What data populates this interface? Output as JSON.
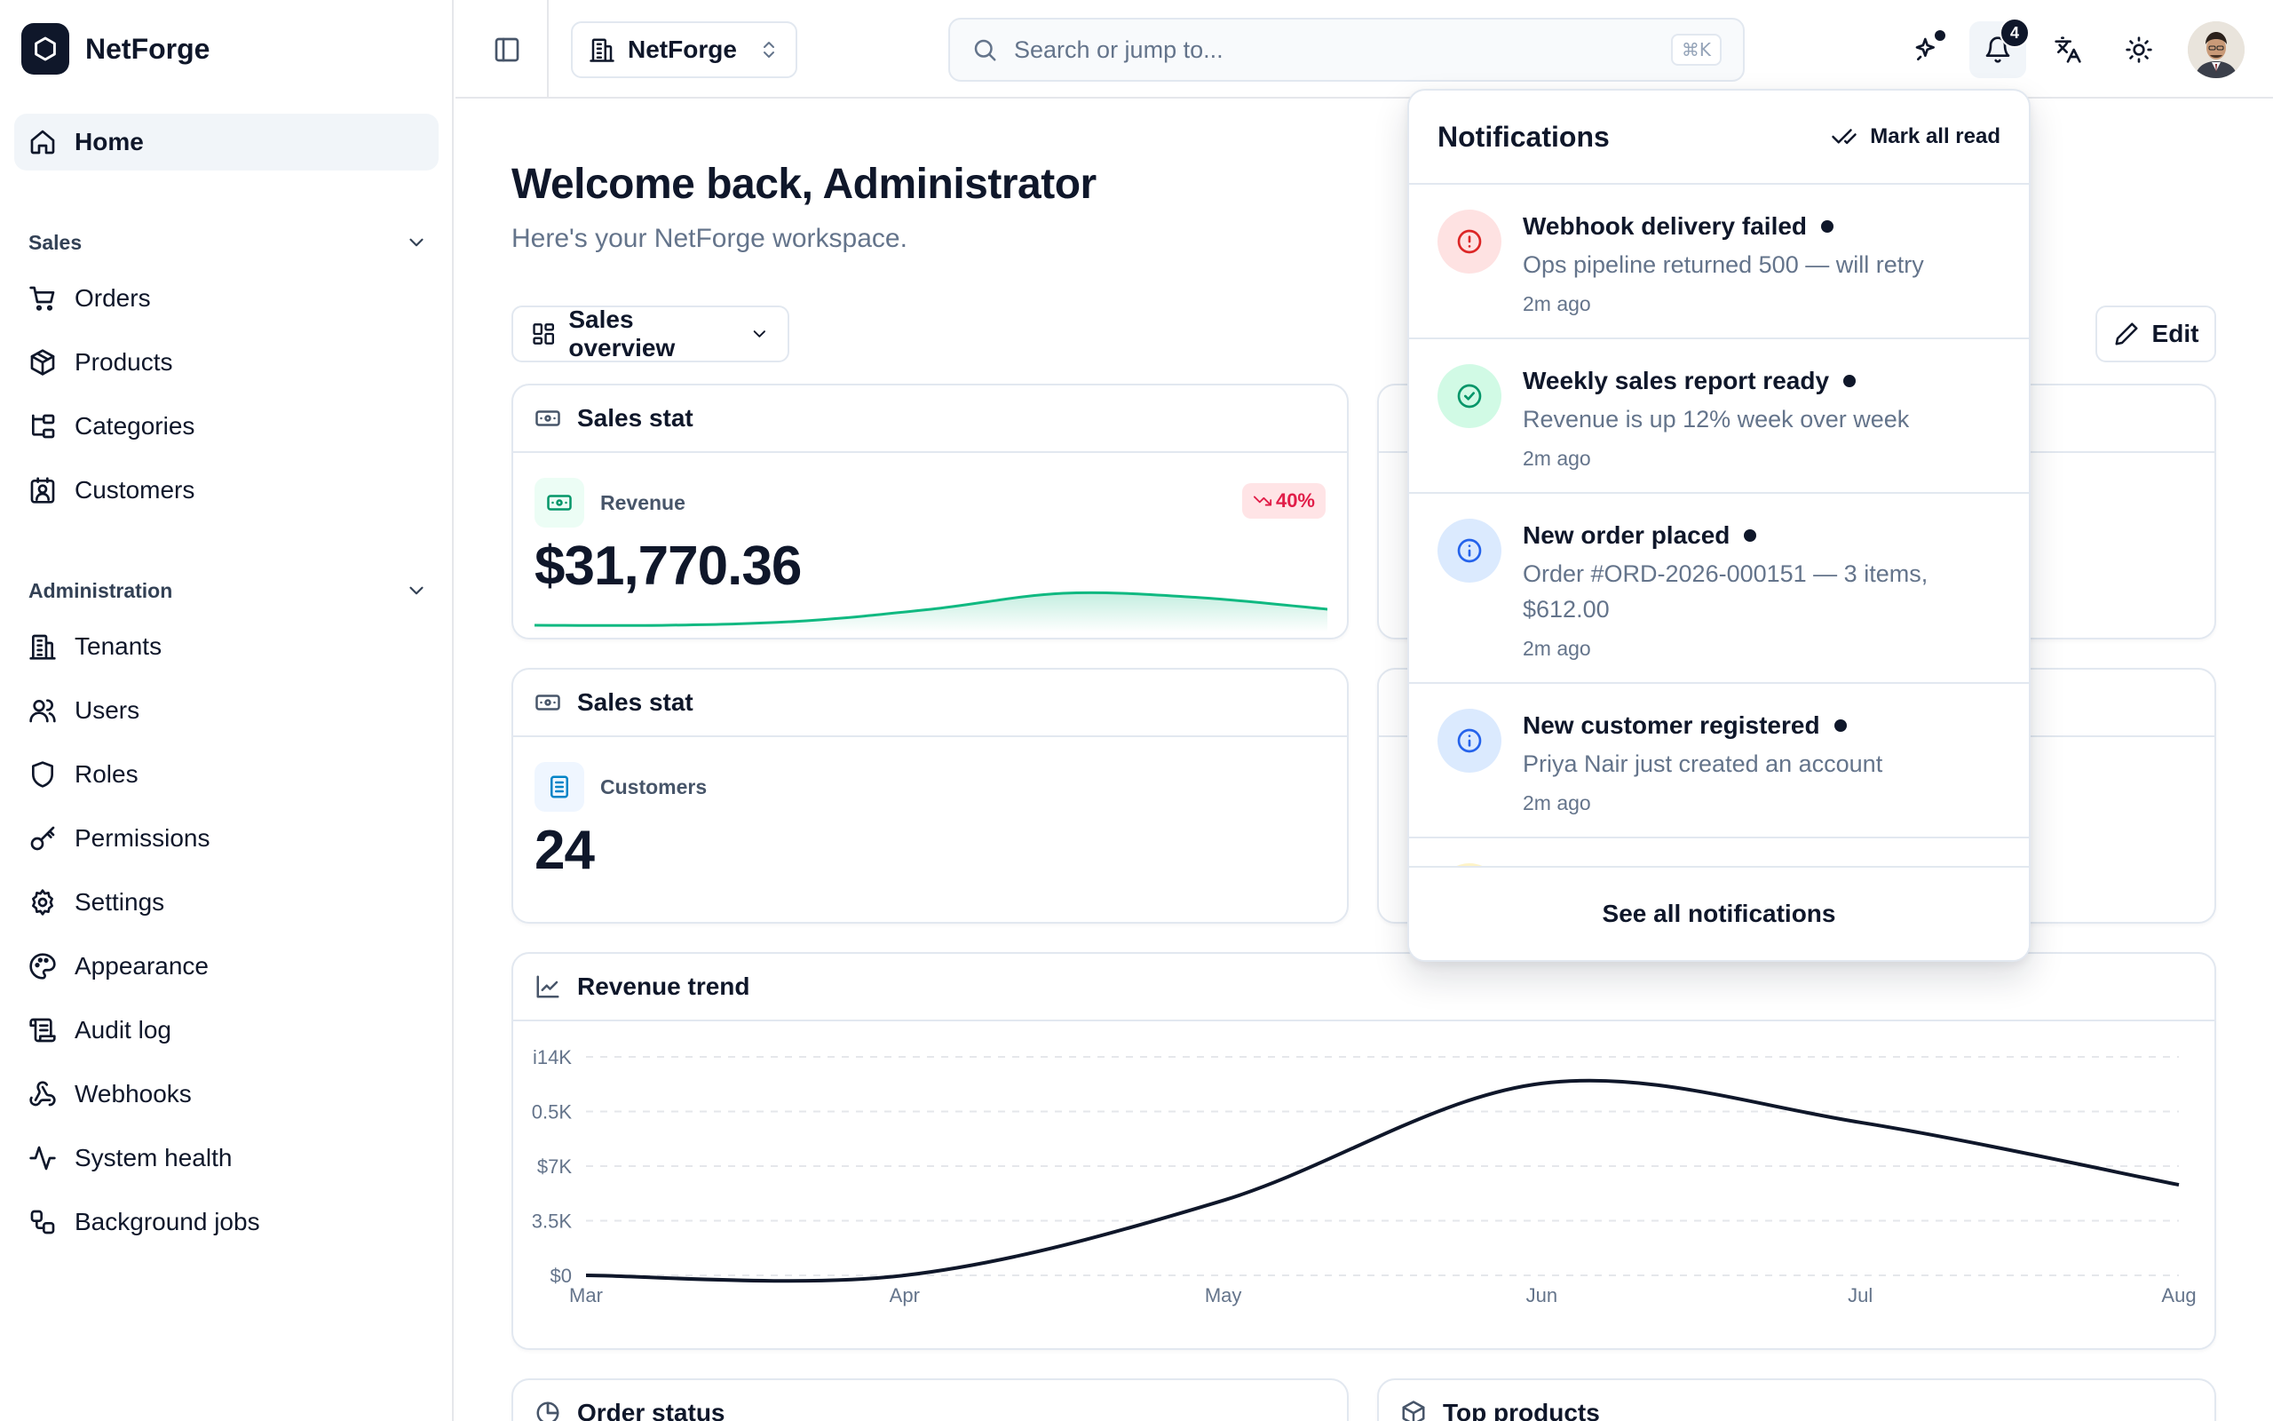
{
  "app": {
    "name": "NetForge"
  },
  "sidebar": {
    "home": "Home",
    "sections": [
      {
        "title": "Sales",
        "items": [
          "Orders",
          "Products",
          "Categories",
          "Customers"
        ]
      },
      {
        "title": "Administration",
        "items": [
          "Tenants",
          "Users",
          "Roles",
          "Permissions",
          "Settings",
          "Appearance",
          "Audit log",
          "Webhooks",
          "System health",
          "Background jobs"
        ]
      }
    ]
  },
  "header": {
    "tenant": "NetForge",
    "search_placeholder": "Search or jump to...",
    "search_shortcut": "⌘K",
    "notification_count": "4"
  },
  "main": {
    "title": "Welcome back, Administrator",
    "subtitle": "Here's your NetForge workspace.",
    "dashboard_select": "Sales overview",
    "edit_label": "Edit",
    "stat_cards": [
      {
        "title": "Sales stat",
        "label": "Revenue",
        "value": "$31,770.36",
        "trend": "40%",
        "trend_direction": "down",
        "sparkline": [
          0,
          0,
          0.5,
          2,
          4,
          3.5,
          2
        ]
      },
      {
        "title": "Sales stat",
        "label": "Customers",
        "value": "24"
      }
    ],
    "revenue_trend": {
      "title": "Revenue trend"
    },
    "bottom_cards": [
      "Order status",
      "Top products"
    ]
  },
  "chart_data": {
    "type": "line",
    "title": "Revenue trend",
    "x": [
      "Mar",
      "Apr",
      "May",
      "Jun",
      "Jul",
      "Aug"
    ],
    "y_tick_labels": [
      "$0",
      "3.5K",
      "$7K",
      "0.5K",
      "i14K"
    ],
    "ylim": [
      0,
      14000
    ],
    "series": [
      {
        "values": [
          0,
          0,
          4800,
          12300,
          9800,
          5800
        ]
      }
    ],
    "grid": true
  },
  "notifications": {
    "title": "Notifications",
    "mark_all": "Mark all read",
    "see_all": "See all notifications",
    "items": [
      {
        "kind": "error",
        "title": "Webhook delivery failed",
        "message": "Ops pipeline returned 500 — will retry",
        "time": "2m ago"
      },
      {
        "kind": "success",
        "title": "Weekly sales report ready",
        "message": "Revenue is up 12% week over week",
        "time": "2m ago"
      },
      {
        "kind": "info",
        "title": "New order placed",
        "message": "Order #ORD-2026-000151 — 3 items, $612.00",
        "time": "2m ago"
      },
      {
        "kind": "info",
        "title": "New customer registered",
        "message": "Priya Nair just created an account",
        "time": "2m ago"
      }
    ]
  },
  "colors": {
    "primary": "#0f172a",
    "accent_green": "#10b981",
    "danger": "#e11d48",
    "info": "#2563eb"
  }
}
